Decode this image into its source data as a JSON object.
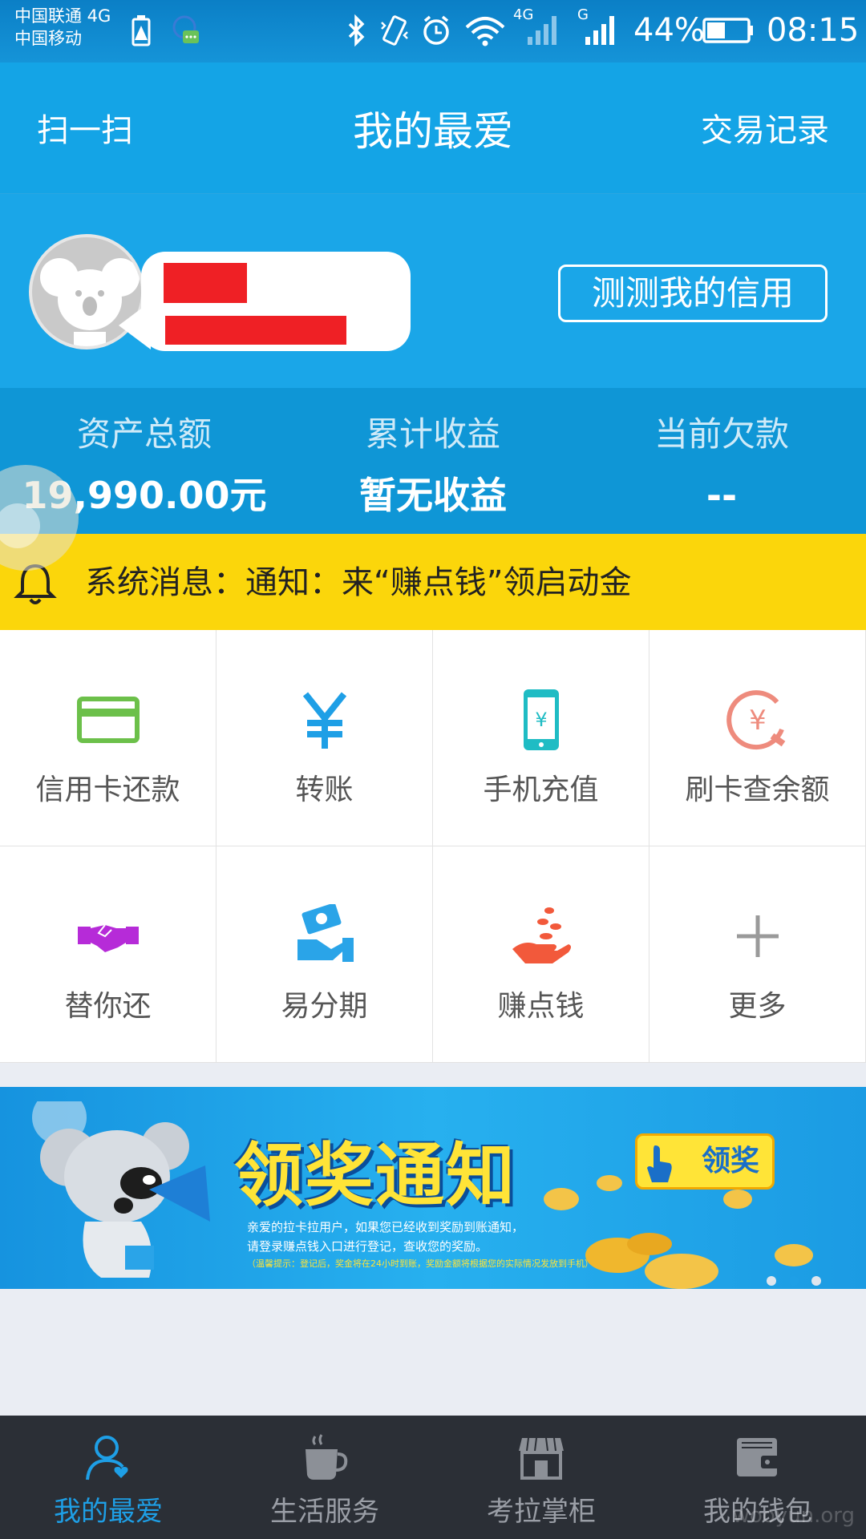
{
  "status_bar": {
    "carrier_1": "中国联通 4G",
    "carrier_2": "中国移动",
    "network_4g": "4G",
    "network_g": "G",
    "battery": "44%",
    "time": "08:15",
    "icons": [
      "battery-alert-icon",
      "chat-notification-icon",
      "bluetooth-icon",
      "vibrate-icon",
      "alarm-icon",
      "wifi-icon",
      "signal-icon",
      "signal-icon",
      "battery-icon"
    ]
  },
  "header": {
    "left": "扫一扫",
    "title": "我的最爱",
    "right": "交易记录"
  },
  "profile": {
    "credit_button": "测测我的信用"
  },
  "stats": [
    {
      "label": "资产总额",
      "value": "19,990.00元"
    },
    {
      "label": "累计收益",
      "value": "暂无收益"
    },
    {
      "label": "当前欠款",
      "value": "--"
    }
  ],
  "notice": {
    "text": "系统消息：通知：来“赚点钱”领启动金"
  },
  "services": [
    {
      "label": "信用卡还款",
      "icon": "credit-card-icon"
    },
    {
      "label": "转账",
      "icon": "yuan-icon"
    },
    {
      "label": "手机充值",
      "icon": "phone-recharge-icon"
    },
    {
      "label": "刷卡查余额",
      "icon": "balance-check-icon"
    },
    {
      "label": "替你还",
      "icon": "handshake-icon"
    },
    {
      "label": "易分期",
      "icon": "installment-icon"
    },
    {
      "label": "赚点钱",
      "icon": "coins-hand-icon"
    },
    {
      "label": "更多",
      "icon": "plus-icon"
    }
  ],
  "banner": {
    "headline": "领奖通知",
    "button": "领奖",
    "line1": "亲爱的拉卡拉用户，如果您已经收到奖励到账通知，",
    "line2": "请登录赚点钱入口进行登记，查收您的奖励。",
    "line3": "（温馨提示：登记后，奖金将在24小时到账，奖励金额将根据您的实际情况发放到手机）"
  },
  "tabs": [
    {
      "label": "我的最爱",
      "icon": "user-heart-icon",
      "active": true
    },
    {
      "label": "生活服务",
      "icon": "coffee-cup-icon",
      "active": false
    },
    {
      "label": "考拉掌柜",
      "icon": "shop-icon",
      "active": false
    },
    {
      "label": "我的钱包",
      "icon": "wallet-icon",
      "active": false
    }
  ],
  "colors": {
    "primary": "#14a4e6",
    "notice_bg": "#fbd60b",
    "tab_active": "#1e9fe6",
    "tabbar_bg": "#2b2f36"
  },
  "watermark": "wooyun.org"
}
